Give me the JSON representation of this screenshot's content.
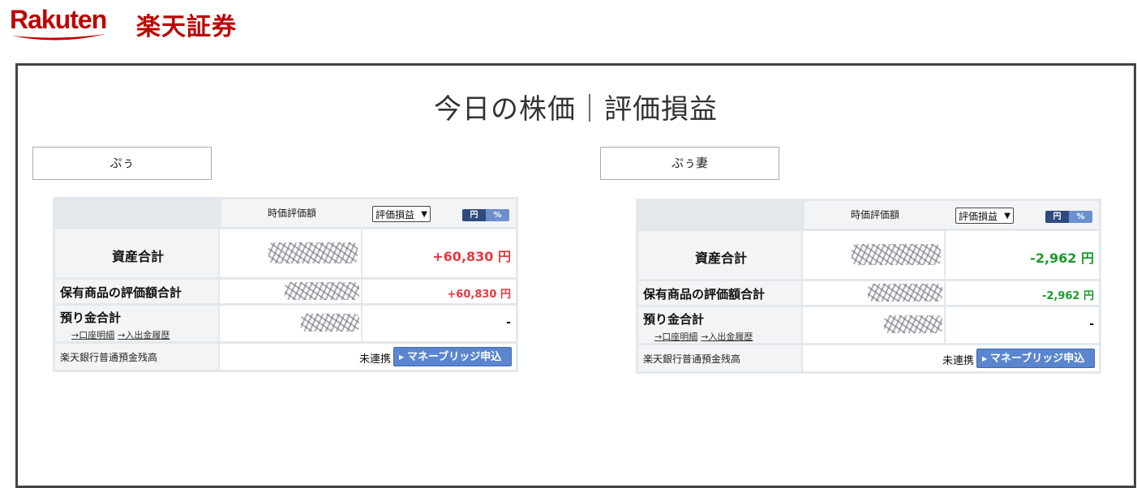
{
  "brand": {
    "wordmark": "Rakuten",
    "jp_name": "楽天証券",
    "color": "#bf0000"
  },
  "page_title": "今日の株価｜評価損益",
  "columns": {
    "market_value": "時価評価額",
    "select_value": "評価損益",
    "toggle_yen": "円",
    "toggle_pct": "%"
  },
  "rows": {
    "total_assets": "資産合計",
    "holdings_total": "保有商品の評価額合計",
    "deposit_total": "預り金合計",
    "account_detail_link": "→口座明細",
    "deposit_history_link": "→入出金履歴",
    "bank_balance": "楽天銀行普通預金残高"
  },
  "bank": {
    "status": "未連携",
    "button": "マネーブリッジ申込"
  },
  "accounts": [
    {
      "name": "ぷぅ",
      "total_pl": "+60,830 円",
      "holdings_pl": "+60,830 円",
      "deposit_pl": "-",
      "status_color": "#e8383d"
    },
    {
      "name": "ぷぅ妻",
      "total_pl": "-2,962 円",
      "holdings_pl": "-2,962 円",
      "deposit_pl": "-",
      "status_color": "#1b9a2a"
    }
  ]
}
